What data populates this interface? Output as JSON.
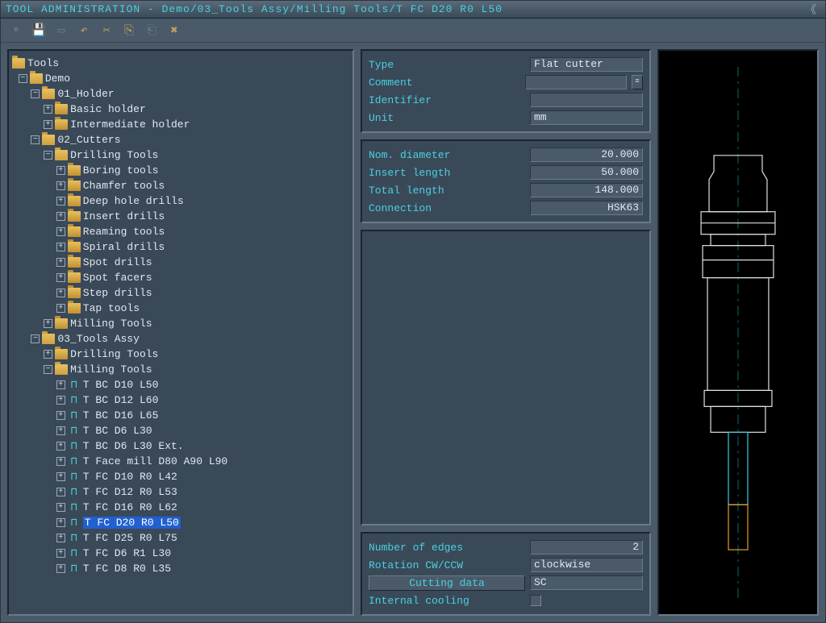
{
  "title": "TOOL ADMINISTRATION - Demo/03_Tools Assy/Milling Tools/T FC D20 R0 L50",
  "toolbar": {
    "new": "new-icon",
    "save": "save-icon",
    "open": "open-icon",
    "undo": "undo-icon",
    "cut": "cut-icon",
    "copy": "copy-icon",
    "paste": "paste-icon",
    "delete": "delete-icon"
  },
  "tree": {
    "root": "Tools",
    "demo": "Demo",
    "holder": "01_Holder",
    "holder_basic": "Basic holder",
    "holder_inter": "Intermediate holder",
    "cutters": "02_Cutters",
    "drilling": "Drilling Tools",
    "boring": "Boring tools",
    "chamfer": "Chamfer tools",
    "deephole": "Deep hole drills",
    "insertdrills": "Insert drills",
    "reaming": "Reaming tools",
    "spiral": "Spiral drills",
    "spot": "Spot drills",
    "spotfacers": "Spot facers",
    "step": "Step drills",
    "tap": "Tap tools",
    "milling": "Milling Tools",
    "assy": "03_Tools Assy",
    "assy_drilling": "Drilling Tools",
    "assy_milling": "Milling Tools",
    "t1": "T BC D10 L50",
    "t2": "T BC D12 L60",
    "t3": "T BC D16 L65",
    "t4": "T BC D6 L30",
    "t5": "T BC D6 L30 Ext.",
    "t6": "T Face mill D80 A90 L90",
    "t7": "T FC D10 R0 L42",
    "t8": "T FC D12 R0 L53",
    "t9": "T FC D16 R0 L62",
    "t10": "T FC D20 R0 L50",
    "t11": "T FC D25 R0 L75",
    "t12": "T FC D6 R1 L30",
    "t13": "T FC D8 R0 L35"
  },
  "props1": {
    "type_label": "Type",
    "type_value": "Flat cutter",
    "comment_label": "Comment",
    "comment_value": "",
    "identifier_label": "Identifier",
    "identifier_value": "",
    "unit_label": "Unit",
    "unit_value": "mm"
  },
  "props2": {
    "diam_label": "Nom. diameter",
    "diam_value": "20.000",
    "insert_label": "Insert length",
    "insert_value": "50.000",
    "total_label": "Total length",
    "total_value": "148.000",
    "conn_label": "Connection",
    "conn_value": "HSK63"
  },
  "props3": {
    "edges_label": "Number of edges",
    "edges_value": "2",
    "rotation_label": "Rotation CW/CCW",
    "rotation_value": "clockwise",
    "cutting_label": "Cutting data",
    "cutting_value": "SC",
    "cooling_label": "Internal cooling"
  }
}
